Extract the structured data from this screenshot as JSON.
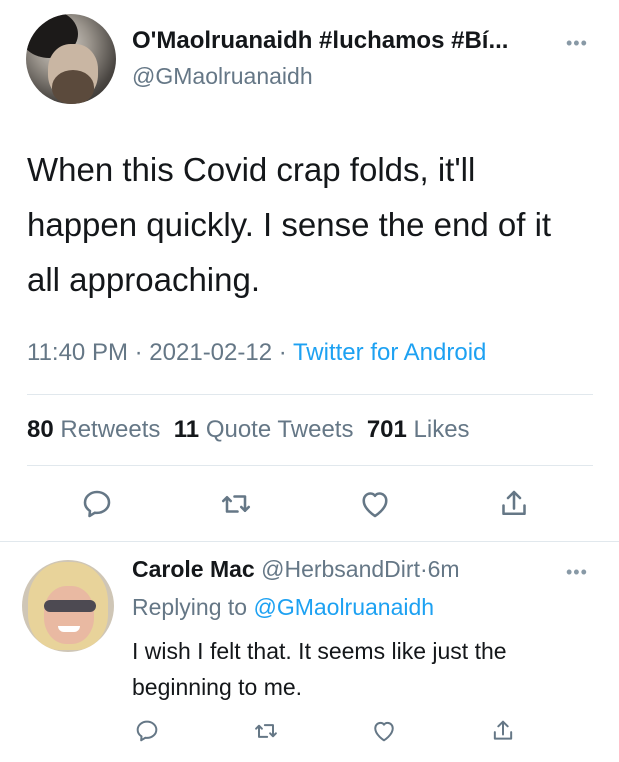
{
  "tweet": {
    "display_name": "O'Maolruanaidh #luchamos #Bí...",
    "handle": "@GMaolruanaidh",
    "text": "When this Covid crap folds, it'll happen quickly. I sense the end of it all approaching.",
    "time": "11:40 PM",
    "date": "2021-02-12",
    "separator": "·",
    "source": "Twitter for Android",
    "stats": {
      "retweets_count": "80",
      "retweets_label": "Retweets",
      "quotes_count": "11",
      "quotes_label": "Quote Tweets",
      "likes_count": "701",
      "likes_label": "Likes"
    },
    "more_icon": "•••"
  },
  "reply": {
    "display_name": "Carole Mac",
    "handle": "@HerbsandDirt",
    "separator": "·",
    "age": "6m",
    "replying_label": "Replying to",
    "replying_target": "@GMaolruanaidh",
    "text": "I wish I felt that. It seems like just the beginning to me.",
    "more_icon": "•••"
  },
  "icons": [
    "reply-icon",
    "retweet-icon",
    "like-icon",
    "share-icon"
  ],
  "colors": {
    "accent": "#1da1f2",
    "secondary_text": "#657786",
    "divider": "#e1e8ed",
    "icon": "#657786"
  }
}
